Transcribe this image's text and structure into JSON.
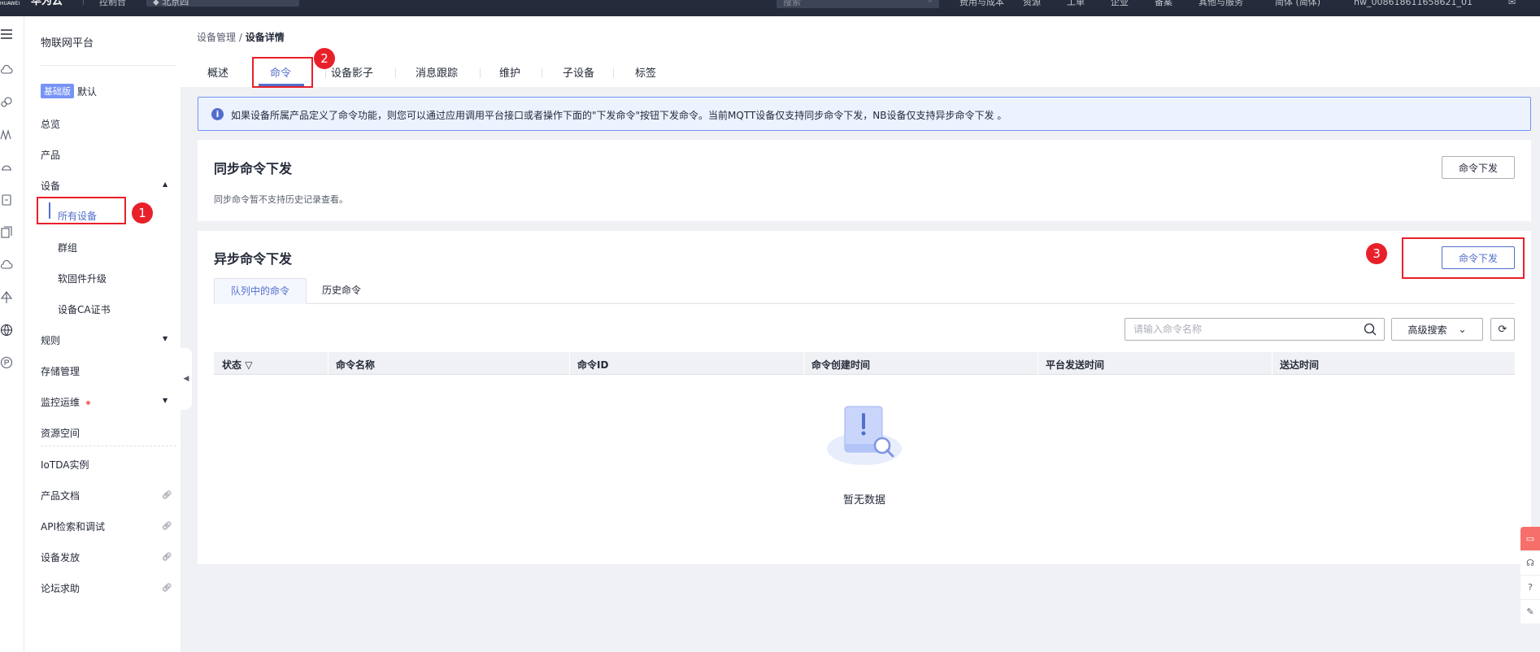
{
  "topbar": {
    "logo": "HUAWEI",
    "brand": "华为云",
    "console": "控制台",
    "region": "北京四",
    "search_placeholder": "搜索",
    "nav": [
      "费用与成本",
      "资源",
      "工单",
      "企业",
      "备案",
      "其他与服务",
      "简体 (简体)"
    ],
    "user": "hw_008618611658621_01",
    "msg_icon": "mail-icon"
  },
  "rail": {
    "icons": [
      "menu-icon",
      "cloud-icon",
      "cloud-service-icon",
      "network-icon",
      "device-icon",
      "box-icon",
      "document-icon",
      "cloud-upload-icon",
      "tree-icon",
      "globe-icon",
      "p-icon"
    ]
  },
  "leftnav": {
    "title": "物联网平台",
    "edition_badge": "基础版",
    "edition_label": "默认",
    "items": {
      "overview": "总览",
      "product": "产品",
      "device": "设备",
      "all_devices": "所有设备",
      "groups": "群组",
      "firmware": "软固件升级",
      "ca_cert": "设备CA证书",
      "rules": "规则",
      "storage": "存储管理",
      "monitoring": "监控运维",
      "resource_space": "资源空间",
      "iotda_instance": "IoTDA实例",
      "product_docs": "产品文档",
      "api_explorer": "API检索和调试",
      "device_provision": "设备发放",
      "forum": "论坛求助"
    }
  },
  "breadcrumb": {
    "parent": "设备管理",
    "separator": " / ",
    "current": "设备详情"
  },
  "tabs": [
    "概述",
    "命令",
    "设备影子",
    "消息跟踪",
    "维护",
    "子设备",
    "标签"
  ],
  "info": {
    "icon": "i",
    "text": "如果设备所属产品定义了命令功能，则您可以通过应用调用平台接口或者操作下面的\"下发命令\"按钮下发命令。当前MQTT设备仅支持同步命令下发，NB设备仅支持异步命令下发 。"
  },
  "sync": {
    "title": "同步命令下发",
    "subtitle": "同步命令暂不支持历史记录查看。",
    "button": "命令下发"
  },
  "async": {
    "title": "异步命令下发",
    "button": "命令下发",
    "subtabs": [
      "队列中的命令",
      "历史命令"
    ],
    "search_placeholder": "请输入命令名称",
    "advanced_search": "高级搜索",
    "columns": [
      "状态",
      "命令名称",
      "命令ID",
      "命令创建时间",
      "平台发送时间",
      "送达时间"
    ],
    "empty_text": "暂无数据"
  },
  "annotations": [
    "1",
    "2",
    "3"
  ],
  "colors": {
    "accent": "#526ecc",
    "annotation": "#e8202a",
    "topbar": "#252b3a"
  }
}
